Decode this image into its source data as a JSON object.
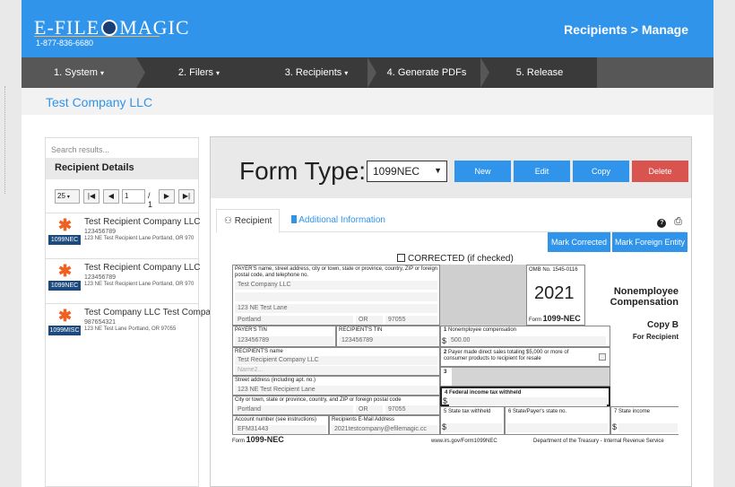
{
  "header": {
    "logo_text": "E-FILE MAGIC",
    "logo_left": "E-File",
    "logo_right": "Magic",
    "phone": "1-877-836-6680",
    "page_title": "Recipients > Manage"
  },
  "nav": {
    "items": [
      {
        "label": "1. System",
        "caret": "▾"
      },
      {
        "label": "2. Filers",
        "caret": "▾"
      },
      {
        "label": "3. Recipients",
        "caret": "▾"
      },
      {
        "label": "4. Generate PDFs",
        "caret": ""
      },
      {
        "label": "5. Release",
        "caret": ""
      }
    ]
  },
  "company": {
    "name": "Test Company LLC"
  },
  "left_panel": {
    "search_placeholder": "Search results...",
    "header": "Recipient Details",
    "pager": {
      "page_size": "25",
      "first": "|◀",
      "prev": "◀",
      "page": "1",
      "of": "/ 1",
      "next": "▶",
      "last": "▶|"
    },
    "recipients": [
      {
        "name": "Test Recipient Company LLC",
        "tin": "123456789",
        "address": "123 NE Test Recipient Lane Portland, OR 970",
        "badge": "1099NEC",
        "icon": "✱"
      },
      {
        "name": "Test Recipient Company LLC",
        "tin": "123456789",
        "address": "123 NE Test Recipient Lane Portland, OR 970",
        "badge": "1099NEC",
        "icon": "✱"
      },
      {
        "name": "Test Company LLC Test Compa",
        "tin": "987654321",
        "address": "123 NE Test Lane Portland, OR 97055",
        "badge": "1099MISC",
        "icon": "✱"
      }
    ]
  },
  "main": {
    "form_type_label": "Form Type:",
    "form_type_value": "1099NEC",
    "buttons": {
      "new": "New",
      "edit": "Edit",
      "copy": "Copy",
      "delete": "Delete"
    },
    "colors": {
      "primary": "#2f94ea",
      "delete": "#d9534f"
    },
    "tabs": [
      {
        "label": "Recipient",
        "icon": "user-icon"
      },
      {
        "label": "Additional Information",
        "icon": "bookmark-icon"
      }
    ],
    "help_icon": "?",
    "print_icon": "⎙",
    "mark_corrected": "Mark Corrected",
    "mark_foreign": "Mark Foreign Entity",
    "corrected_label": "CORRECTED (if checked)"
  },
  "form": {
    "payer_label": "PAYER'S name, street address, city or town, state or province, country, ZIP or foreign postal code, and telephone no.",
    "payer_name": "Test Company LLC",
    "payer_street": "123 NE Test Lane",
    "payer_city": "Portland",
    "payer_state": "OR",
    "payer_zip": "97055",
    "omb": "OMB No. 1545-0116",
    "year": "2021",
    "form_label": "Form",
    "form_name": "1099-NEC",
    "title": "Nonemployee Compensation",
    "copy": "Copy B",
    "for_recipient": "For Recipient",
    "payer_tin_label": "PAYER'S TIN",
    "payer_tin": "123456789",
    "recipient_tin_label": "RECIPIENT'S TIN",
    "recipient_tin": "123456789",
    "box1_num": "1",
    "box1_label": "Nonemployee compensation",
    "box1_value": "500.00",
    "dollar": "$",
    "recipient_name_label": "RECIPIENT'S name",
    "recipient_name": "Test Recipient Company LLC",
    "name2_placeholder": "Name2...",
    "box2_num": "2",
    "box2_label": "Payer made direct sales totaling $5,000 or more of consumer products to recipient for resale",
    "street_label": "Street address (including apt. no.)",
    "recipient_street": "123 NE Test Recipient Lane",
    "box3_num": "3",
    "city_label": "City or town, state or province, country, and ZIP or foreign postal code",
    "box4_label": "4 Federal income tax withheld",
    "recipient_city": "Portland",
    "recipient_state": "OR",
    "recipient_zip": "97055",
    "box5_label": "5 State tax withheld",
    "box6_label": "6 State/Payer's state no.",
    "box7_label": "7 State income",
    "account_label": "Account number (see instructions)",
    "account": "EFM31443",
    "email_label": "Recipients E-Mail Address",
    "email": "2021testcompany@efilemagic.cc",
    "footer_form": "Form",
    "footer_form_name": "1099-NEC",
    "footer_url": "www.irs.gov/Form1099NEC",
    "footer_dept": "Department of the Treasury - Internal Revenue Service"
  }
}
